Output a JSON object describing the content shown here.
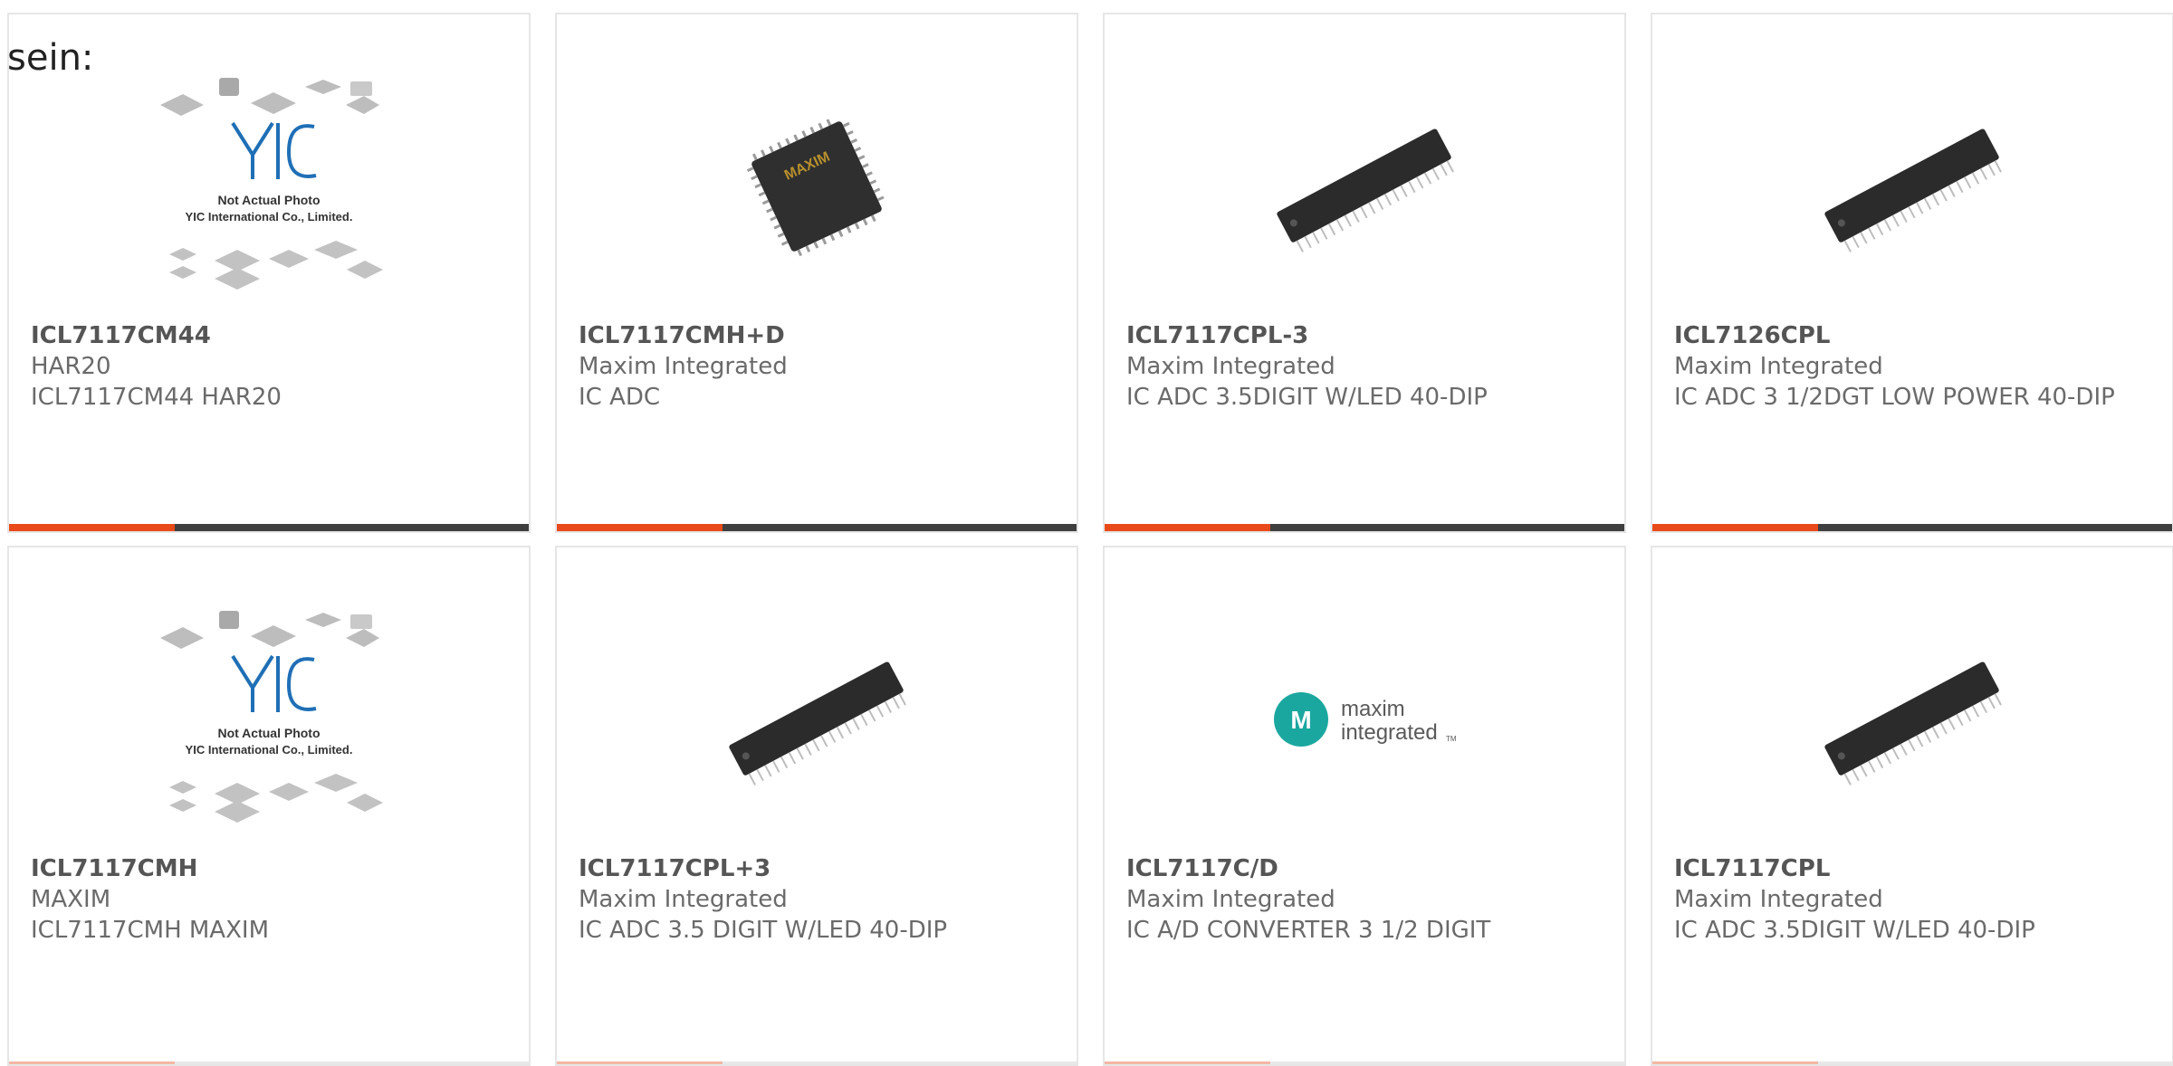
{
  "page": {
    "lead_text": "sein:"
  },
  "placeholder_texts": {
    "caption_1": "Not Actual Photo",
    "caption_2": "YIC International Co., Limited.",
    "yic_logo_text": "YIC"
  },
  "brand_logo": {
    "line1": "maxim",
    "line2": "integrated",
    "tm": "TM",
    "mark": "M"
  },
  "chip_marking": "MAXIM",
  "colors": {
    "accent": "#e84a1a",
    "bar": "#3f3f3f",
    "yic_blue": "#1f6fb6",
    "maxim_teal": "#1aa7a0"
  },
  "products": [
    {
      "part_number": "ICL7117CM44",
      "manufacturer": "HAR20",
      "description": "ICL7117CM44 HAR20",
      "image": "yic-placeholder"
    },
    {
      "part_number": "ICL7117CMH+D",
      "manufacturer": "Maxim Integrated",
      "description": "IC ADC",
      "image": "qfp-chip"
    },
    {
      "part_number": "ICL7117CPL-3",
      "manufacturer": "Maxim Integrated",
      "description": "IC ADC 3.5DIGIT W/LED 40-DIP",
      "image": "dip-chip"
    },
    {
      "part_number": "ICL7126CPL",
      "manufacturer": "Maxim Integrated",
      "description": "IC ADC 3 1/2DGT LOW POWER 40-DIP",
      "image": "dip-chip"
    },
    {
      "part_number": "ICL7117CMH",
      "manufacturer": "MAXIM",
      "description": "ICL7117CMH MAXIM",
      "image": "yic-placeholder"
    },
    {
      "part_number": "ICL7117CPL+3",
      "manufacturer": "Maxim Integrated",
      "description": "IC ADC 3.5 DIGIT W/LED 40-DIP",
      "image": "dip-chip"
    },
    {
      "part_number": "ICL7117C/D",
      "manufacturer": "Maxim Integrated",
      "description": "IC A/D CONVERTER 3 1/2 DIGIT",
      "image": "maxim-logo"
    },
    {
      "part_number": "ICL7117CPL",
      "manufacturer": "Maxim Integrated",
      "description": "IC ADC 3.5DIGIT W/LED 40-DIP",
      "image": "dip-chip"
    }
  ]
}
